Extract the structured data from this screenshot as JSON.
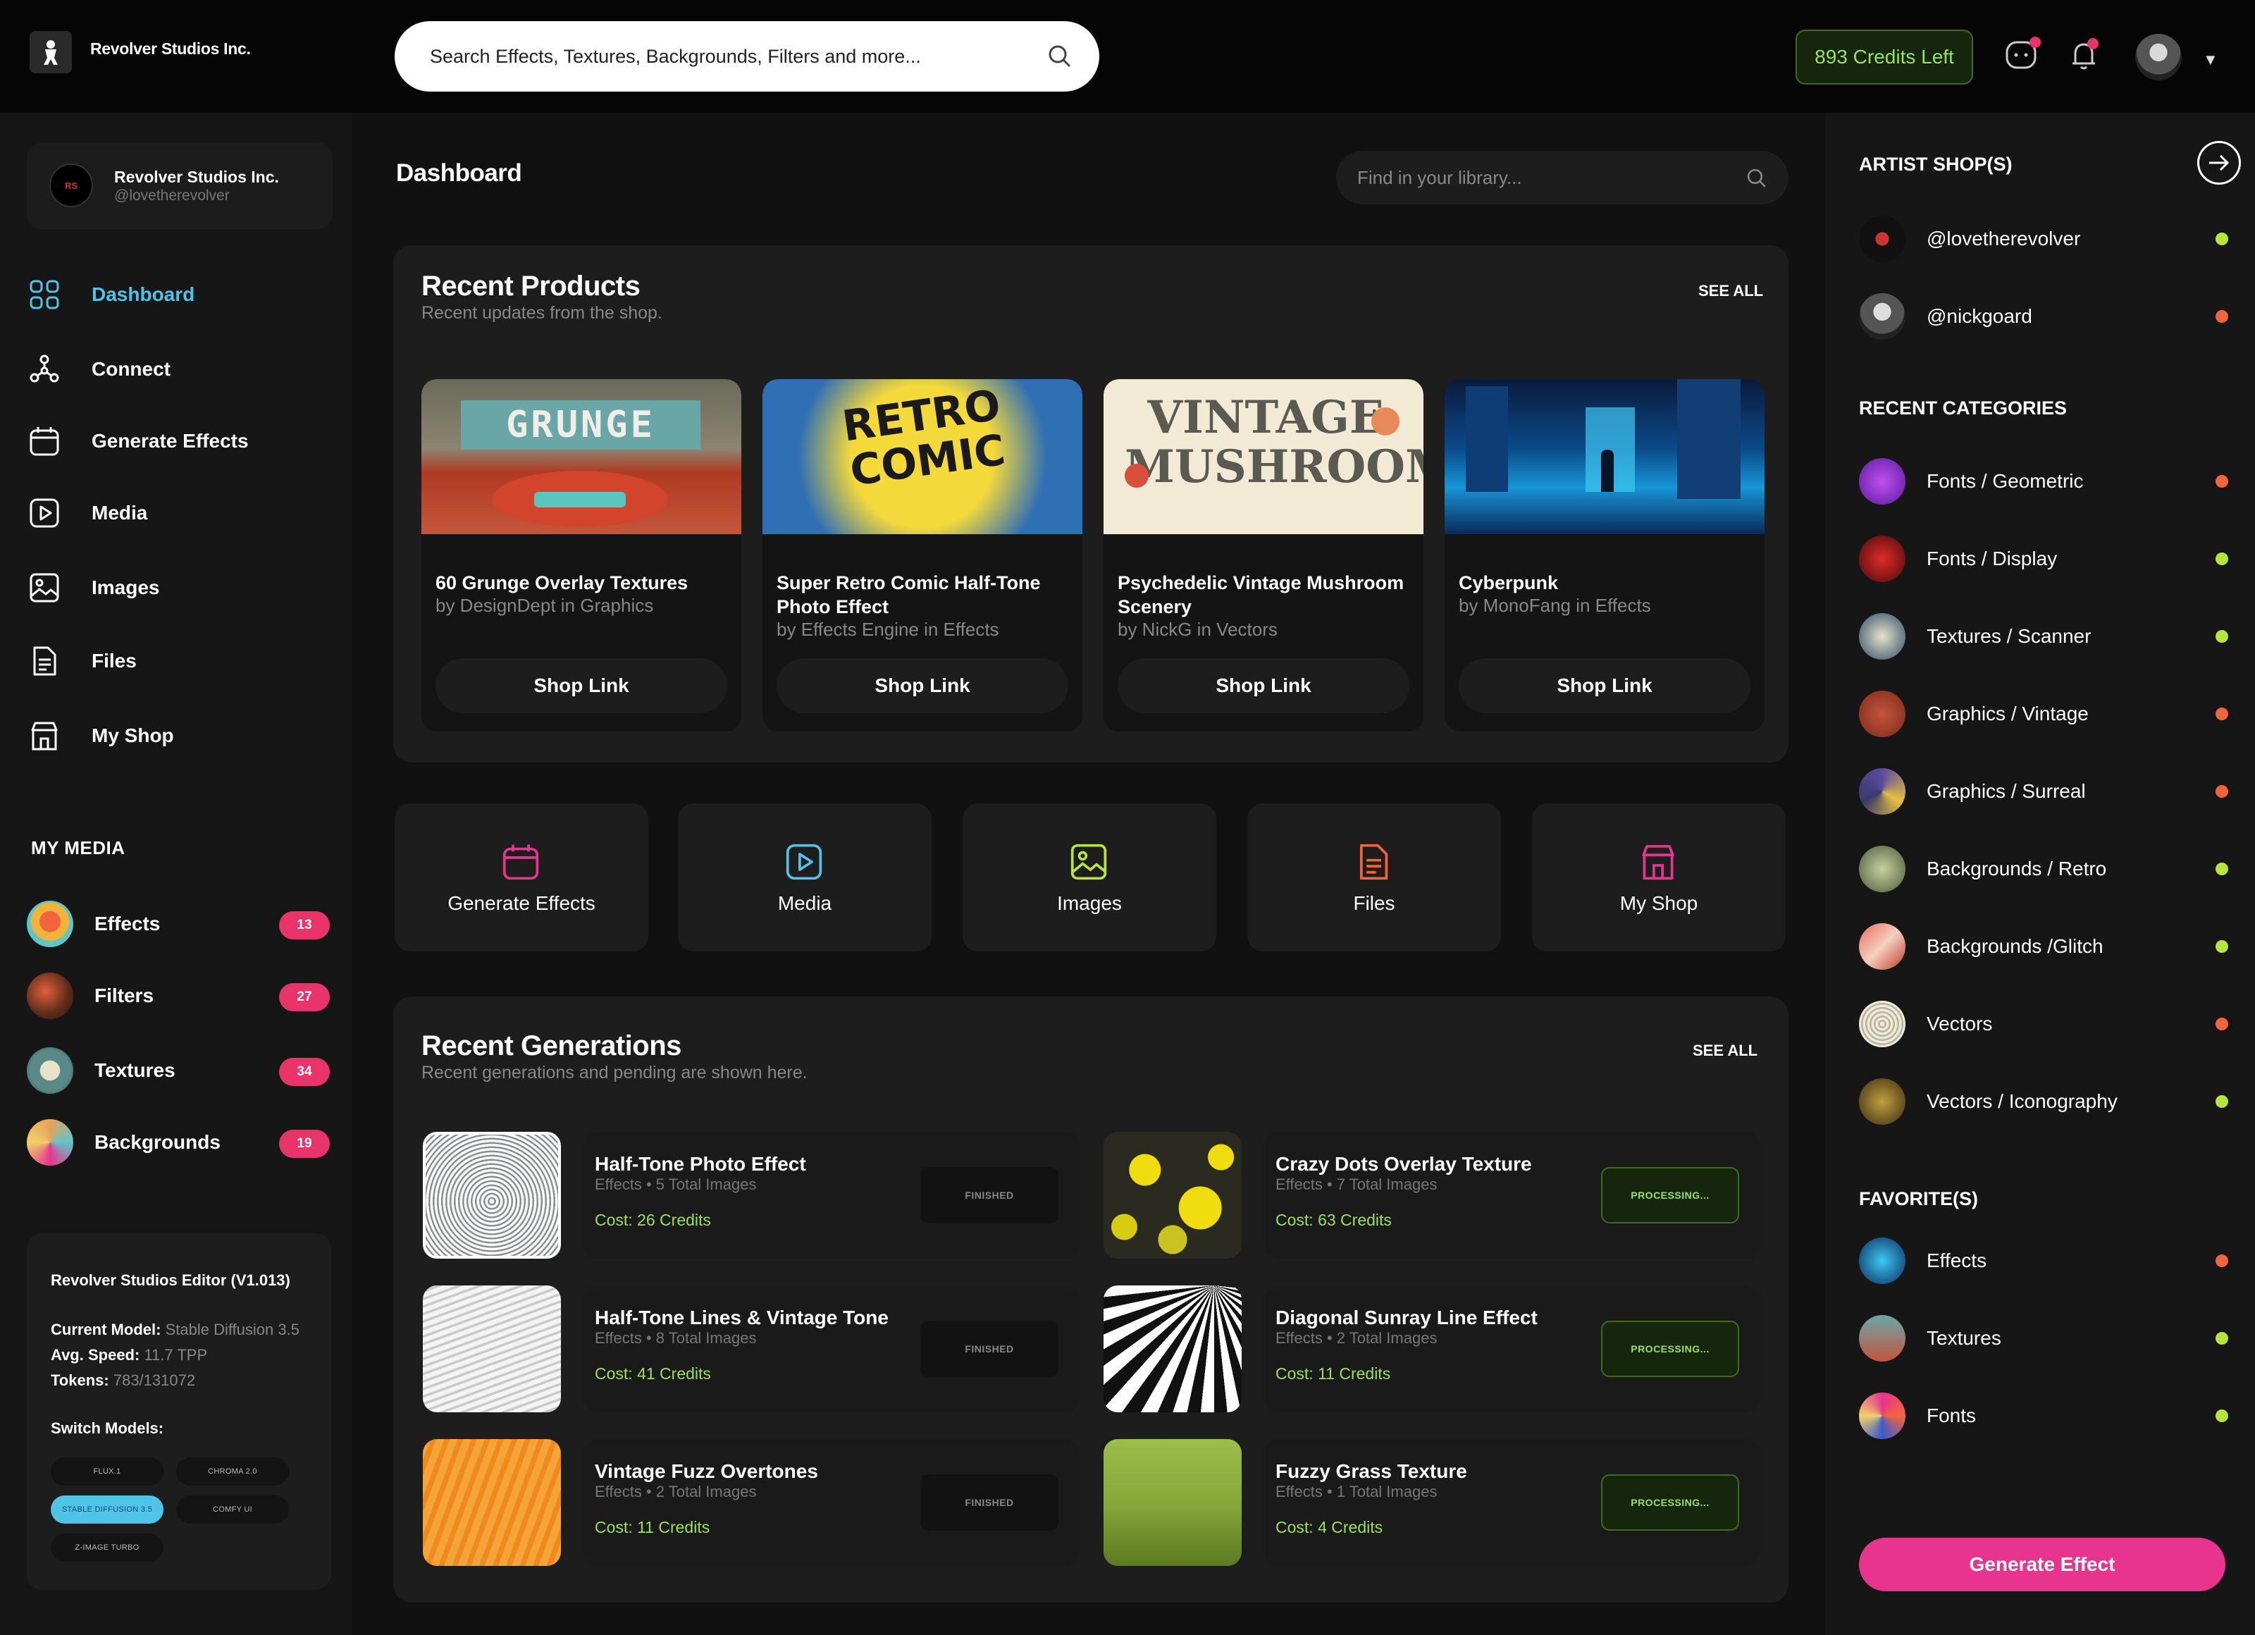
{
  "header": {
    "brand": "Revolver Studios Inc.",
    "search_placeholder": "Search Effects, Textures, Backgrounds, Filters and more...",
    "credits": "893 Credits Left"
  },
  "profile": {
    "name": "Revolver Studios Inc.",
    "handle": "@lovetherevolver"
  },
  "nav": [
    {
      "label": "Dashboard",
      "icon": "dashboard-icon"
    },
    {
      "label": "Connect",
      "icon": "connect-icon"
    },
    {
      "label": "Generate Effects",
      "icon": "calendar-icon"
    },
    {
      "label": "Media",
      "icon": "play-icon"
    },
    {
      "label": "Images",
      "icon": "image-icon"
    },
    {
      "label": "Files",
      "icon": "file-icon"
    },
    {
      "label": "My Shop",
      "icon": "shop-icon"
    }
  ],
  "my_media": {
    "title": "MY MEDIA",
    "items": [
      {
        "label": "Effects",
        "count": "13"
      },
      {
        "label": "Filters",
        "count": "27"
      },
      {
        "label": "Textures",
        "count": "34"
      },
      {
        "label": "Backgrounds",
        "count": "19"
      }
    ]
  },
  "editor": {
    "title": "Revolver Studios Editor (V1.013)",
    "model_label": "Current Model:",
    "model_value": "Stable Diffusion 3.5",
    "speed_label": "Avg. Speed:",
    "speed_value": "11.7 TPP",
    "tokens_label": "Tokens:",
    "tokens_value": "783/131072",
    "switch_label": "Switch Models:",
    "models": [
      "FLUX.1",
      "CHROMA 2.0",
      "STABLE DIFFUSION 3.5",
      "COMFY UI",
      "Z-IMAGE TURBO"
    ],
    "active_model": "STABLE DIFFUSION 3.5"
  },
  "main": {
    "title": "Dashboard",
    "library_placeholder": "Find in your library...",
    "recent_products": {
      "title": "Recent Products",
      "subtitle": "Recent updates from the shop.",
      "see_all": "SEE ALL",
      "items": [
        {
          "title": "60 Grunge Overlay Textures",
          "byline": "by DesignDept in Graphics",
          "button": "Shop Link",
          "thumb_text": "GRUNGE"
        },
        {
          "title": "Super Retro Comic Half-Tone Photo Effect",
          "byline": "by Effects Engine in Effects",
          "button": "Shop Link",
          "thumb_text": "RETRO COMIC"
        },
        {
          "title": "Psychedelic Vintage Mushroom Scenery",
          "byline": "by NickG in Vectors",
          "button": "Shop Link",
          "thumb_text": "VINTAGE MUSHROOM"
        },
        {
          "title": "Cyberpunk",
          "byline": "by MonoFang in Effects",
          "button": "Shop Link",
          "thumb_text": ""
        }
      ]
    },
    "quick_actions": [
      {
        "label": "Generate Effects",
        "color": "#e8348f"
      },
      {
        "label": "Media",
        "color": "#4fc3e8"
      },
      {
        "label": "Images",
        "color": "#b6e63e"
      },
      {
        "label": "Files",
        "color": "#f2643c"
      },
      {
        "label": "My Shop",
        "color": "#e8348f"
      }
    ],
    "recent_generations": {
      "title": "Recent Generations",
      "subtitle": "Recent generations and pending are shown here.",
      "see_all": "SEE ALL",
      "items": [
        {
          "title": "Half-Tone Photo Effect",
          "meta": "Effects • 5 Total Images",
          "cost": "Cost: 26 Credits",
          "status": "FINISHED"
        },
        {
          "title": "Crazy Dots Overlay Texture",
          "meta": "Effects • 7 Total Images",
          "cost": "Cost: 63 Credits",
          "status": "PROCESSING..."
        },
        {
          "title": "Half-Tone Lines & Vintage Tone",
          "meta": "Effects • 8 Total Images",
          "cost": "Cost: 41 Credits",
          "status": "FINISHED"
        },
        {
          "title": "Diagonal Sunray Line Effect",
          "meta": "Effects • 2 Total Images",
          "cost": "Cost: 11 Credits",
          "status": "PROCESSING..."
        },
        {
          "title": "Vintage Fuzz Overtones",
          "meta": "Effects • 2 Total Images",
          "cost": "Cost: 11 Credits",
          "status": "FINISHED"
        },
        {
          "title": "Fuzzy Grass Texture",
          "meta": "Effects • 1 Total Images",
          "cost": "Cost: 4 Credits",
          "status": "PROCESSING..."
        }
      ]
    }
  },
  "right": {
    "artist_title": "ARTIST SHOP(S)",
    "artists": [
      {
        "label": "@lovetherevolver",
        "status": "green"
      },
      {
        "label": "@nickgoard",
        "status": "orange"
      }
    ],
    "categories_title": "RECENT CATEGORIES",
    "categories": [
      {
        "label": "Fonts / Geometric",
        "status": "orange"
      },
      {
        "label": "Fonts / Display",
        "status": "green"
      },
      {
        "label": "Textures / Scanner",
        "status": "green"
      },
      {
        "label": "Graphics / Vintage",
        "status": "orange"
      },
      {
        "label": "Graphics / Surreal",
        "status": "orange"
      },
      {
        "label": "Backgrounds / Retro",
        "status": "green"
      },
      {
        "label": "Backgrounds /Glitch",
        "status": "green"
      },
      {
        "label": "Vectors",
        "status": "orange"
      },
      {
        "label": "Vectors / Iconography",
        "status": "green"
      }
    ],
    "favorites_title": "FAVORITE(S)",
    "favorites": [
      {
        "label": "Effects",
        "status": "orange"
      },
      {
        "label": "Textures",
        "status": "green"
      },
      {
        "label": "Fonts",
        "status": "green"
      }
    ],
    "generate_button": "Generate Effect"
  }
}
